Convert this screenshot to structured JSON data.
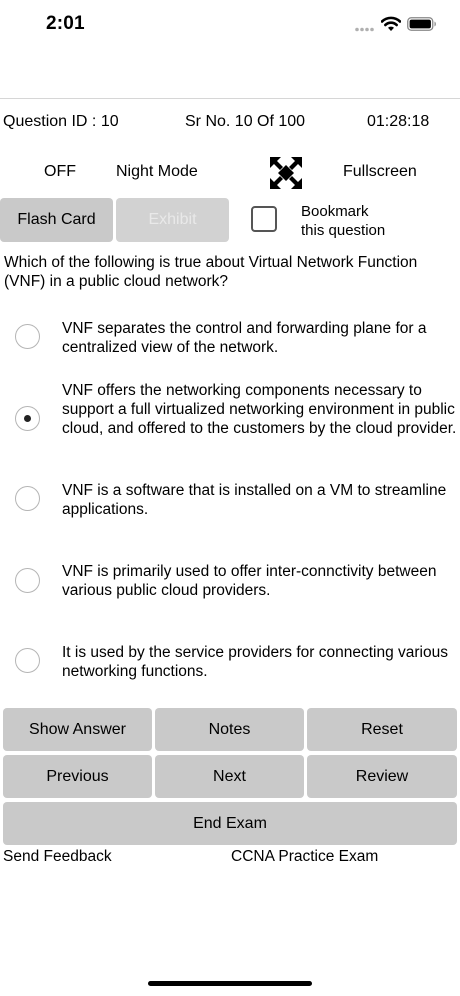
{
  "status_bar": {
    "time": "2:01"
  },
  "info_bar": {
    "question_id": "Question ID : 10",
    "serial": "Sr No. 10 Of 100",
    "timer": "01:28:18"
  },
  "settings": {
    "night_mode_state": "OFF",
    "night_mode_label": "Night Mode",
    "fullscreen_icon": "fullscreen-arrows-icon",
    "fullscreen_label": "Fullscreen"
  },
  "actions": {
    "flash_card": "Flash Card",
    "exhibit": "Exhibit",
    "bookmark_line1": "Bookmark",
    "bookmark_line2": "this question"
  },
  "question": {
    "text": "Which of the following is true about Virtual Network Function (VNF) in a public cloud network?",
    "selected_index": 1,
    "options": [
      "VNF separates the control and forwarding plane for a centralized view of the network.",
      "VNF offers the networking components necessary to support a full virtualized networking environment in public cloud, and offered to the customers by the cloud provider.",
      "VNF is a software that is installed on a VM to streamline applications.",
      "VNF is primarily used to offer inter-connctivity between various public cloud providers.",
      "It is used by the service providers for connecting various networking functions."
    ]
  },
  "controls": {
    "show_answer": "Show Answer",
    "notes": "Notes",
    "reset": "Reset",
    "previous": "Previous",
    "next": "Next",
    "review": "Review",
    "end_exam": "End Exam"
  },
  "footer": {
    "feedback": "Send Feedback",
    "app_name": "CCNA Practice Exam"
  },
  "colors": {
    "button_bg": "#c9c9c9",
    "disabled_text": "#e9e9e9"
  }
}
